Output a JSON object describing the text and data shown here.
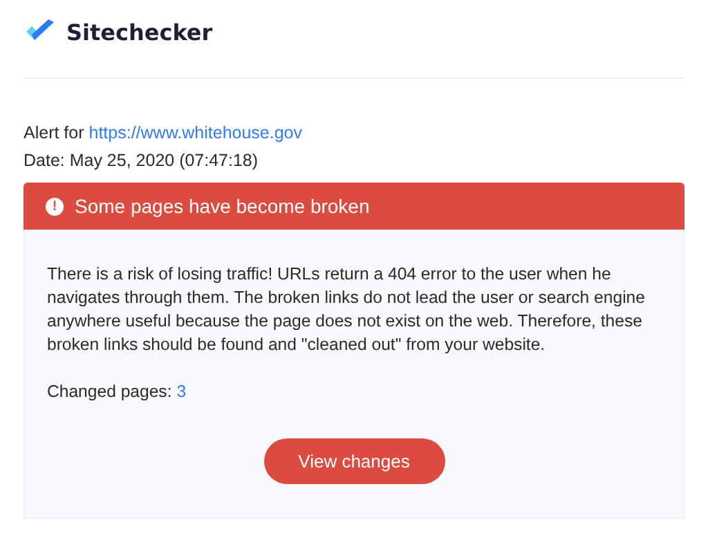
{
  "brand": {
    "name": "Sitechecker"
  },
  "alert": {
    "prefix": "Alert for",
    "url": "https://www.whitehouse.gov",
    "date": "Date: May 25, 2020 (07:47:18)"
  },
  "banner": {
    "icon": "!",
    "title": "Some pages have become broken"
  },
  "card": {
    "description": "There is a risk of losing traffic! URLs return a 404 error to the user when he navigates through them. The broken links do not lead the user or search engine anywhere useful because the page does not exist on the web. Therefore, these broken links should be found and \"cleaned out\" from your website.",
    "changed_label": "Changed pages:",
    "changed_count": "3",
    "button": "View changes"
  }
}
